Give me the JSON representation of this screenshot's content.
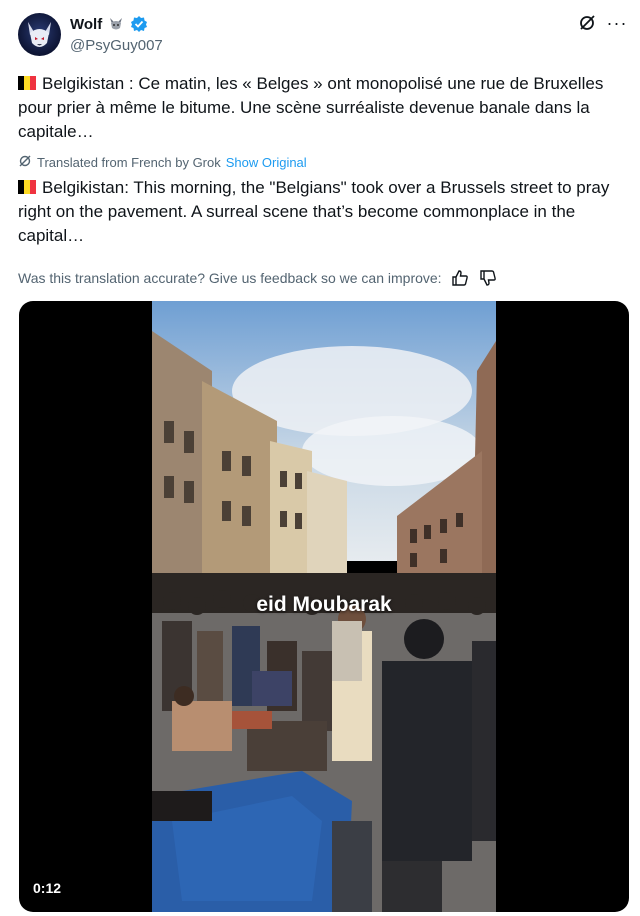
{
  "author": {
    "display_name": "Wolf",
    "handle": "@PsyGuy007",
    "avatar_icon": "wolf-avatar-icon",
    "emoji_icon": "wolf-emoji-icon",
    "verified_icon": "verified-badge-icon",
    "verified_color": "#1d9bf0"
  },
  "header_actions": {
    "grok_icon": "grok-icon",
    "more_label": "···"
  },
  "tweet": {
    "flag_icon": "belgium-flag-icon",
    "flag_colors": [
      "#000000",
      "#fdda24",
      "#ef3340"
    ],
    "original_text": "Belgikistan : Ce matin, les « Belges » ont monopolisé une rue de Bruxelles pour prier à même le bitume. Une scène surréaliste devenue banale dans la capitale…",
    "translated_label": "Translated from French by Grok",
    "show_original_label": "Show Original",
    "translated_text": "Belgikistan: This morning, the \"Belgians\" took over a Brussels street to pray right on the pavement. A surreal scene that’s become commonplace in the capital…",
    "feedback_prompt": "Was this translation accurate? Give us feedback so we can improve:",
    "thumbs_up_icon": "thumbs-up-icon",
    "thumbs_down_icon": "thumbs-down-icon"
  },
  "media": {
    "overlay_caption": "eid Moubarak",
    "duration": "0:12"
  },
  "colors": {
    "link": "#1d9bf0",
    "secondary_text": "#536471"
  }
}
